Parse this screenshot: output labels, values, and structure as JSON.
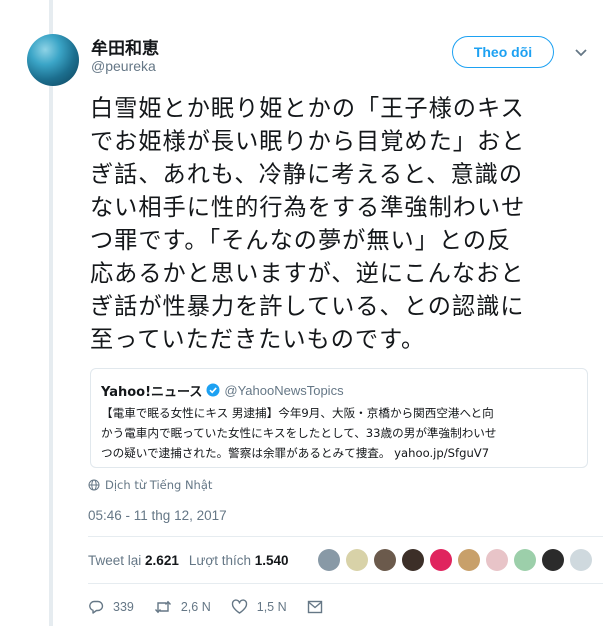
{
  "author": {
    "name": "牟田和恵",
    "handle": "@peureka"
  },
  "follow_label": "Theo dõi",
  "tweet_text": "白雪姫とか眠り姫とかの「王子様のキス\nでお姫様が長い眠りから目覚めた」おと\nぎ話、あれも、冷静に考えると、意識の\nない相手に性的行為をする準強制わいせ\nつ罪です。「そんなの夢が無い」との反\n応あるかと思いますが、逆にこんなおと\nぎ話が性暴力を許している、との認識に\n至っていただきたいものです。",
  "quoted": {
    "name": "Yahoo!ニュース",
    "handle": "@YahooNewsTopics",
    "text": "【電車で眠る女性にキス 男逮捕】今年9月、大阪・京橋から関西空港へと向\nかう電車内で眠っていた女性にキスをしたとして、33歳の男が準強制わいせ\nつの疑いで逮捕された。警察は余罪があるとみて捜査。 yahoo.jp/SfguV7"
  },
  "translate_label": "Dịch từ Tiếng Nhật",
  "timestamp": "05:46 - 11 thg 12, 2017",
  "stats": {
    "retweets_label": "Tweet lại",
    "retweets": "2.621",
    "likes_label": "Lượt thích",
    "likes": "1.540"
  },
  "actions": {
    "replies": "339",
    "retweets": "2,6 N",
    "likes": "1,5 N"
  },
  "colors": {
    "accent": "#1da1f2",
    "muted": "#657786",
    "divider": "#e6ecf0"
  },
  "icons": [
    "chevron-down-icon",
    "verified-icon",
    "globe-icon",
    "reply-icon",
    "retweet-icon",
    "heart-icon",
    "message-icon"
  ]
}
